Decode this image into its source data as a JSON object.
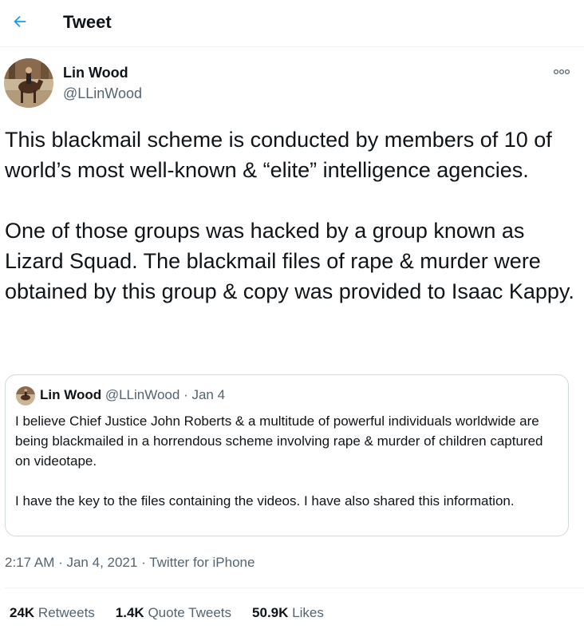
{
  "header": {
    "title": "Tweet",
    "back_icon": "arrow-left-icon",
    "accent": "#1d9bf0"
  },
  "author": {
    "name": "Lin Wood",
    "handle": "@LLinWood"
  },
  "tweet": {
    "paragraphs": [
      "This blackmail scheme is conducted by members of 10 of world’s most well-known & “elite” intelligence agencies.",
      "One of those groups was hacked by a group known as Lizard Squad. The blackmail files of rape & murder were obtained by this group & copy was provided to Isaac Kappy."
    ]
  },
  "quote": {
    "name": "Lin Wood",
    "handle": "@LLinWood",
    "date": " · Jan 4",
    "paragraphs": [
      "I believe Chief Justice John Roberts & a multitude of powerful individuals worldwide are being blackmailed in a horrendous scheme involving rape & murder of children captured on videotape.",
      "I have the key to the files containing the videos. I have also shared this information."
    ]
  },
  "meta": {
    "time": "2:17 AM · Jan 4, 2021",
    "separator": " · ",
    "source": "Twitter for iPhone"
  },
  "stats": {
    "retweets": {
      "count": "24K",
      "label": "Retweets"
    },
    "quotes": {
      "count": "1.4K",
      "label": "Quote Tweets"
    },
    "likes": {
      "count": "50.9K",
      "label": "Likes"
    }
  }
}
